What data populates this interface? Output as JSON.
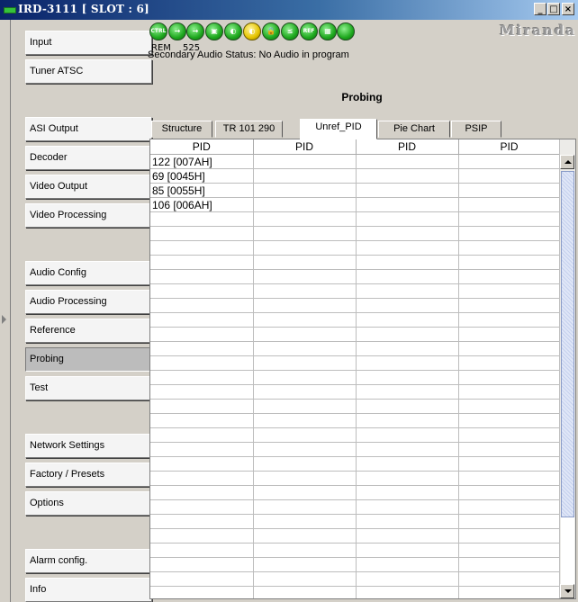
{
  "window": {
    "title": "IRD-3111 [ SLOT : 6]"
  },
  "sidebar": {
    "items": [
      {
        "label": "Input"
      },
      {
        "label": "Tuner ATSC"
      },
      {
        "label": "ASI Output"
      },
      {
        "label": "Decoder"
      },
      {
        "label": "Video Output"
      },
      {
        "label": "Video Processing"
      },
      {
        "label": "Audio Config"
      },
      {
        "label": "Audio Processing"
      },
      {
        "label": "Reference"
      },
      {
        "label": "Probing",
        "active": true
      },
      {
        "label": "Test"
      },
      {
        "label": "Network Settings"
      },
      {
        "label": "Factory / Presets"
      },
      {
        "label": "Options"
      },
      {
        "label": "Alarm config."
      },
      {
        "label": "Info"
      }
    ]
  },
  "status": {
    "icons": [
      {
        "name": "ctrl-icon",
        "text": "CTRL",
        "color": "green"
      },
      {
        "name": "arrow-right-icon",
        "text": "→",
        "color": "green"
      },
      {
        "name": "arrow-right-icon",
        "text": "→",
        "color": "green"
      },
      {
        "name": "monitor-icon",
        "text": "▣",
        "color": "green"
      },
      {
        "name": "audio-icon",
        "text": "◐",
        "color": "green"
      },
      {
        "name": "audio-warning-icon",
        "text": "◐",
        "color": "yellow"
      },
      {
        "name": "lock-icon",
        "text": "🔒",
        "color": "green"
      },
      {
        "name": "less-equal-icon",
        "text": "≤",
        "color": "green"
      },
      {
        "name": "ref-icon",
        "text": "REF",
        "color": "green"
      },
      {
        "name": "test-pattern-icon",
        "text": "▦",
        "color": "green"
      },
      {
        "name": "status-led-icon",
        "text": "",
        "color": "green"
      }
    ],
    "rem": "REM",
    "format": "525",
    "logo": "Miranda",
    "audio_status": "Secondary Audio Status: No Audio in program"
  },
  "page_title": "Probing",
  "tabs": [
    {
      "label": "Structure"
    },
    {
      "label": "TR 101 290"
    },
    {
      "label": "Unref_PID",
      "active": true
    },
    {
      "label": "Pie Chart"
    },
    {
      "label": "PSIP"
    }
  ],
  "table": {
    "headers": [
      "PID",
      "PID",
      "PID",
      "PID"
    ],
    "rows": [
      [
        "122 [007AH]",
        "",
        "",
        ""
      ],
      [
        "69 [0045H]",
        "",
        "",
        ""
      ],
      [
        "85 [0055H]",
        "",
        "",
        ""
      ],
      [
        "106 [006AH]",
        "",
        "",
        ""
      ]
    ],
    "empty_rows": 27
  },
  "colors": {
    "titlebar": "#0a246a",
    "active_item": "#bcbcbc",
    "status_green": "#1ea81e",
    "status_yellow": "#e5c400"
  }
}
